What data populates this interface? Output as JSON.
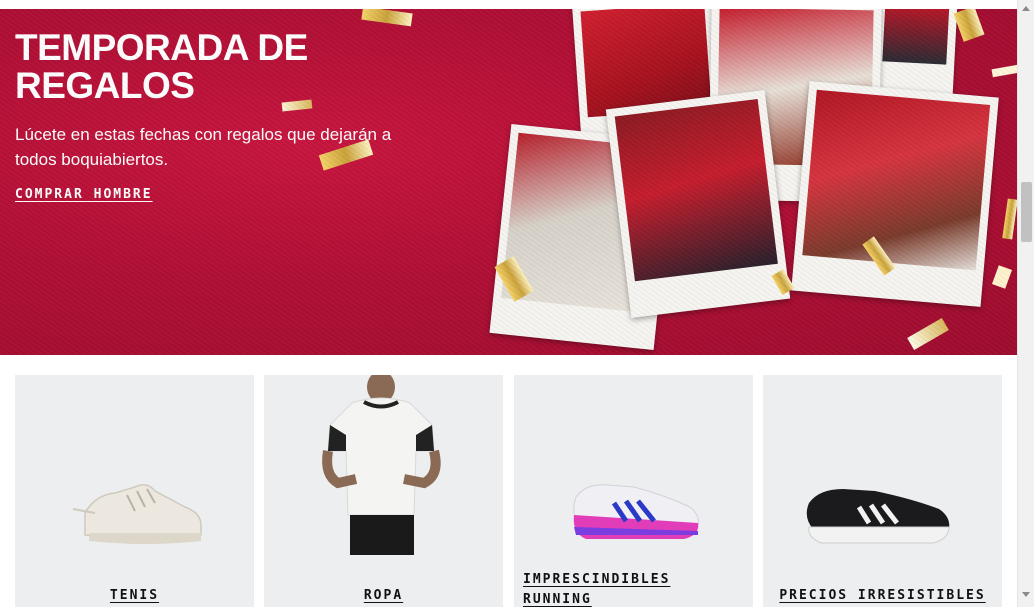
{
  "hero": {
    "title": "TEMPORADA DE REGALOS",
    "subtitle": "Lúcete en estas fechas con regalos que dejarán a todos boquiabiertos.",
    "cta_label": "COMPRAR HOMBRE",
    "background_color": "#b10f35"
  },
  "categories": [
    {
      "label": "TENIS",
      "image": "white-sneaker"
    },
    {
      "label": "ROPA",
      "image": "white-tshirt-model"
    },
    {
      "label": "IMPRESCINDIBLES RUNNING",
      "image": "running-shoe-pink-blue"
    },
    {
      "label": "PRECIOS IRRESISTIBLES",
      "image": "black-running-shoe"
    }
  ]
}
